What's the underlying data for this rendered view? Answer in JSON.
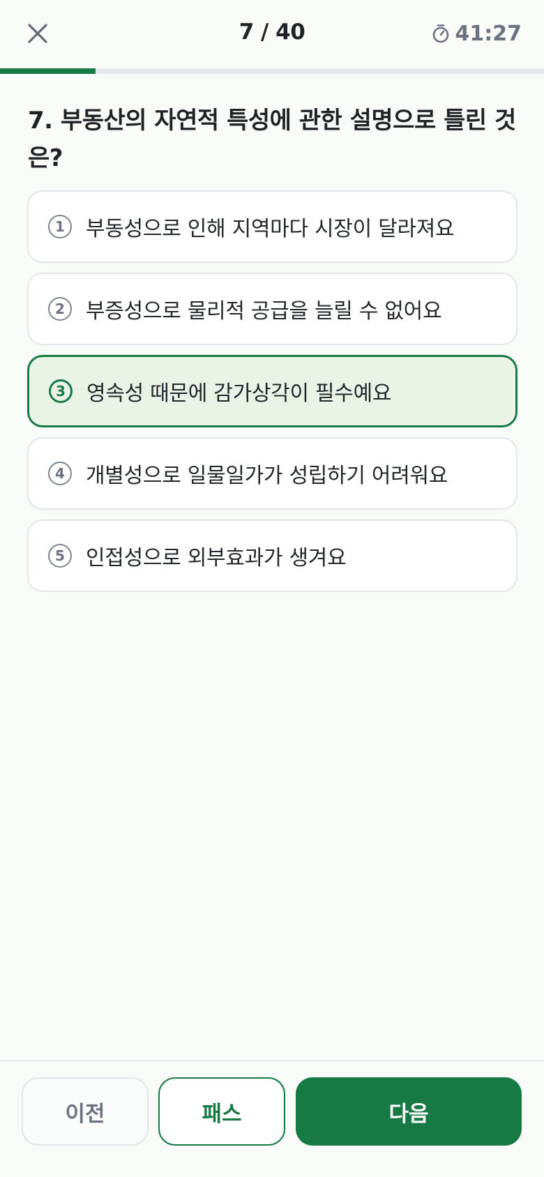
{
  "header": {
    "close_icon": "close-icon",
    "progress_label": "7 / 40",
    "progress_fraction": 0.175,
    "timer_icon": "stopwatch-icon",
    "timer": "41:27"
  },
  "question": {
    "text": "7. 부동산의 자연적 특성에 관한 설명으로 틀린 것은?"
  },
  "options": [
    {
      "num": "1",
      "text": "부동성으로 인해 지역마다 시장이 달라져요",
      "selected": false
    },
    {
      "num": "2",
      "text": "부증성으로 물리적 공급을 늘릴 수 없어요",
      "selected": false
    },
    {
      "num": "3",
      "text": "영속성 때문에 감가상각이 필수예요",
      "selected": true
    },
    {
      "num": "4",
      "text": "개별성으로 일물일가가 성립하기 어려워요",
      "selected": false
    },
    {
      "num": "5",
      "text": "인접성으로 외부효과가 생겨요",
      "selected": false
    }
  ],
  "footer": {
    "prev_label": "이전",
    "pass_label": "패스",
    "next_label": "다음"
  },
  "colors": {
    "accent": "#177a45",
    "selected_bg": "#e9f3e6",
    "background": "#f9fbf8",
    "muted": "#6b7380"
  }
}
